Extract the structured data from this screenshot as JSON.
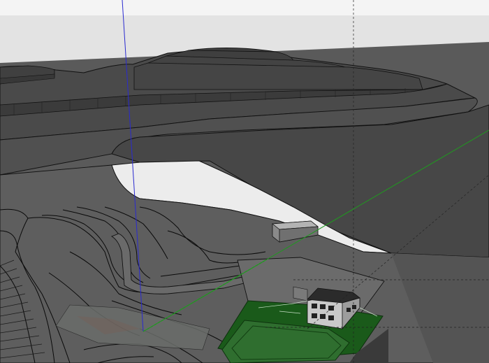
{
  "app": {
    "view": "3d-model-viewport",
    "axes": {
      "red": "#a02020",
      "green": "#1f9a1f",
      "blue": "#2a2ad0"
    },
    "colors": {
      "sky": "#eeeeee",
      "terrain_dark": "#4a4a4a",
      "terrain_mid": "#5b5b5b",
      "terrain_light": "#6e6e6e",
      "flat_area": "#e8e8e8",
      "field_green": "#1a5a1a",
      "field_lawn": "#2f6e2f",
      "edge": "#111111"
    },
    "model": {
      "objects": [
        "terraced-hill",
        "small-terrace-left",
        "road-slope",
        "contour-lines",
        "building-block",
        "house",
        "sports-field",
        "site-plan-ground"
      ]
    }
  }
}
